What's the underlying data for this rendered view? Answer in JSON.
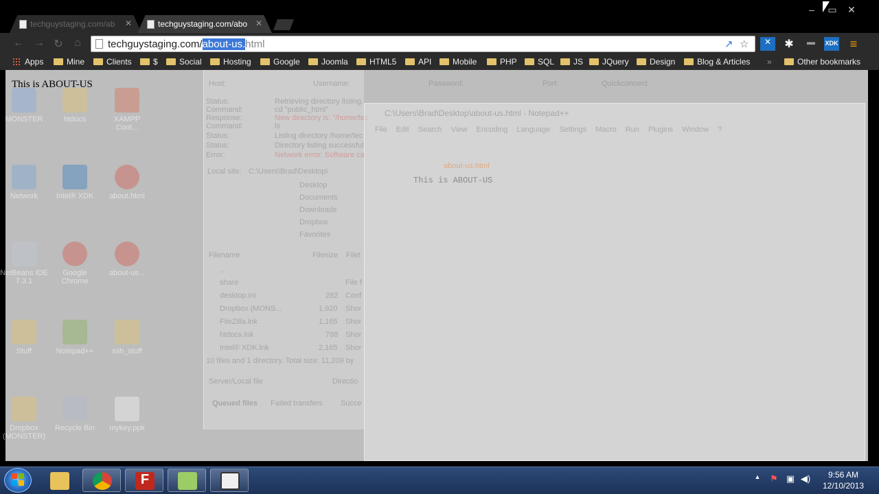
{
  "tabs": [
    {
      "label": "techguystaging.com/ab",
      "active": false
    },
    {
      "label": "techguystaging.com/abo",
      "active": true
    }
  ],
  "window_controls": {
    "minimize": "–",
    "maximize": "▭",
    "close": "✕"
  },
  "nav": {
    "back": "←",
    "forward": "→",
    "reload": "↻",
    "home": "⌂"
  },
  "omnibox": {
    "prefix": "techguystaging.com/",
    "selected": "about-us.",
    "suffix": "html"
  },
  "extensions": [
    {
      "name": "share-icon",
      "label": "↗"
    },
    {
      "name": "star-icon",
      "label": "☆"
    },
    {
      "name": "xdk-x-icon",
      "label": "✕",
      "color": "#1d6fc2"
    },
    {
      "name": "puzzle-icon",
      "label": "✱"
    },
    {
      "name": "download-icon",
      "label": "▬"
    },
    {
      "name": "xdk-icon",
      "label": "XDK",
      "color": "#1d6fc2"
    },
    {
      "name": "menu-icon",
      "label": "≡",
      "color": "#f0a000"
    }
  ],
  "bookmarks": {
    "apps": "Apps",
    "items": [
      "Mine",
      "Clients",
      "$",
      "Social",
      "Hosting",
      "Google",
      "Joomla",
      "HTML5",
      "API",
      "Mobile",
      "PHP",
      "SQL",
      "JS",
      "JQuery",
      "Design",
      "Blog & Articles"
    ],
    "overflow": "»",
    "other": "Other bookmarks"
  },
  "page": {
    "text": "This is ABOUT-US"
  },
  "desktop_icons": [
    {
      "label": "MONSTER"
    },
    {
      "label": "htdocs"
    },
    {
      "label": "XAMPP Cont..."
    },
    {
      "label": "Network"
    },
    {
      "label": "Intel® XDK"
    },
    {
      "label": "about.html"
    },
    {
      "label": "NetBeans IDE 7.3.1"
    },
    {
      "label": "Google Chrome"
    },
    {
      "label": "about-us..."
    },
    {
      "label": "Stuff"
    },
    {
      "label": "Notepad++"
    },
    {
      "label": "ssh_stuff"
    },
    {
      "label": "Dropbox (MONSTER)"
    },
    {
      "label": "Recycle Bin"
    },
    {
      "label": "mykey.ppk"
    }
  ],
  "ghost_notepad": {
    "title": "C:\\Users\\Brad\\Desktop\\about-us.html - Notepad++",
    "menu": "File Edit Search View Encoding Language Settings Macro Run Plugins Window ?",
    "tab": "about-us.html",
    "text": "This is ABOUT-US"
  },
  "ghost_filezilla": {
    "host": "Host:",
    "username": "Username:",
    "password": "Password:",
    "port": "Port:",
    "quickconnect": "Quickconnect",
    "log": [
      "Status:",
      "Command:",
      "Response:",
      "Command:",
      "Status:",
      "Status:",
      "Error:"
    ],
    "log_values": [
      "Retrieving directory listing...",
      "cd \"public_html\"",
      "New directory is: \"/home/tec",
      "ls",
      "Listing directory /home/tec",
      "Directory listing successful",
      "Network error: Software ca"
    ],
    "local_site": "Local site:",
    "local_path": "C:\\Users\\Brad\\Desktop\\",
    "tree": [
      "Desktop",
      "Documents",
      "Downloads",
      "Dropbox",
      "Favorites"
    ],
    "headers": [
      "Filename",
      "Filesize",
      "Filet"
    ],
    "files": [
      {
        "name": "..",
        "size": "",
        "type": ""
      },
      {
        "name": "share",
        "size": "",
        "type": "File f"
      },
      {
        "name": "desktop.ini",
        "size": "282",
        "type": "Conf"
      },
      {
        "name": "Dropbox (MONS...",
        "size": "1,920",
        "type": "Shor"
      },
      {
        "name": "FileZilla.lnk",
        "size": "1,165",
        "type": "Shor"
      },
      {
        "name": "htdocs.lnk",
        "size": "788",
        "type": "Shor"
      },
      {
        "name": "Intel® XDK.lnk",
        "size": "2,165",
        "type": "Shor"
      }
    ],
    "summary": "10 files and 1 directory. Total size: 11,209 by",
    "transfer_headers": [
      "Server/Local file",
      "Directio"
    ],
    "queue_tabs": [
      "Queued files",
      "Failed transfers",
      "Succe"
    ]
  },
  "taskbar": {
    "buttons": [
      {
        "name": "explorer-taskbar-button",
        "color": "#e8c25a"
      },
      {
        "name": "chrome-taskbar-button",
        "color": "#db4437"
      },
      {
        "name": "filezilla-taskbar-button",
        "color": "#c0281e"
      },
      {
        "name": "notepadpp-taskbar-button",
        "color": "#7cb342"
      },
      {
        "name": "app-window-taskbar-button",
        "color": "#e0e0e0"
      }
    ],
    "tray": {
      "up": "▲",
      "flag": "⚑",
      "network": "▣",
      "volume": "◀)"
    },
    "time": "9:56 AM",
    "date": "12/10/2013"
  }
}
